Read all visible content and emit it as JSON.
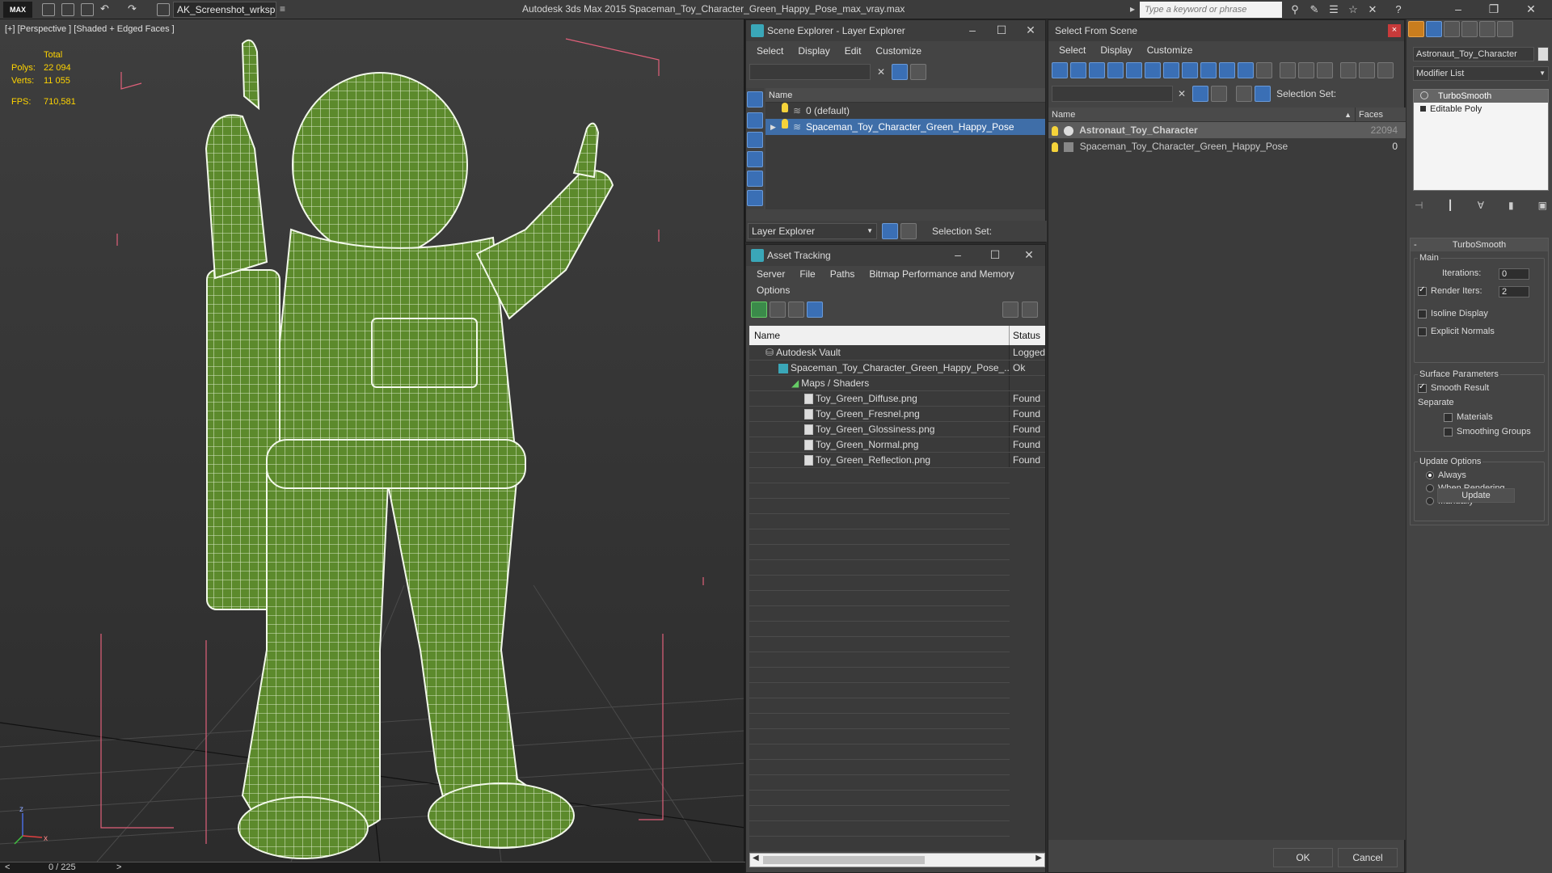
{
  "titlebar": {
    "logo": "MAX",
    "workspace": "AK_Screenshot_wrksp",
    "app_title": "Autodesk 3ds Max  2015     Spaceman_Toy_Character_Green_Happy_Pose_max_vray.max",
    "search_placeholder": "Type a keyword or phrase"
  },
  "viewport": {
    "label": "[+] [Perspective ] [Shaded + Edged Faces ]",
    "stats": {
      "total_label": "Total",
      "polys_label": "Polys:",
      "polys_value": "22 094",
      "verts_label": "Verts:",
      "verts_value": "11 055",
      "fps_label": "FPS:",
      "fps_value": "710,581"
    },
    "axis_x": "x",
    "axis_z": "z",
    "timeline": "0 / 225",
    "timeline_prev": "<",
    "timeline_next": ">"
  },
  "scene_explorer": {
    "title": "Scene Explorer - Layer Explorer",
    "menu": [
      "Select",
      "Display",
      "Edit",
      "Customize"
    ],
    "column": "Name",
    "rows": [
      {
        "label": "0 (default)"
      },
      {
        "label": "Spaceman_Toy_Character_Green_Happy_Pose"
      }
    ],
    "explorer_dropdown": "Layer Explorer",
    "selection_set_label": "Selection Set:"
  },
  "asset_tracking": {
    "title": "Asset Tracking",
    "menu": [
      "Server",
      "File",
      "Paths",
      "Bitmap Performance and Memory"
    ],
    "menu2": "Options",
    "col_name": "Name",
    "col_status": "Status",
    "rows": [
      {
        "name": "Autodesk Vault",
        "status": "Logged",
        "indent": 0
      },
      {
        "name": "Spaceman_Toy_Character_Green_Happy_Pose_...",
        "status": "Ok",
        "indent": 1
      },
      {
        "name": "Maps / Shaders",
        "status": "",
        "indent": 2
      },
      {
        "name": "Toy_Green_Diffuse.png",
        "status": "Found",
        "indent": 3
      },
      {
        "name": "Toy_Green_Fresnel.png",
        "status": "Found",
        "indent": 3
      },
      {
        "name": "Toy_Green_Glossiness.png",
        "status": "Found",
        "indent": 3
      },
      {
        "name": "Toy_Green_Normal.png",
        "status": "Found",
        "indent": 3
      },
      {
        "name": "Toy_Green_Reflection.png",
        "status": "Found",
        "indent": 3
      }
    ]
  },
  "select_from_scene": {
    "title": "Select From Scene",
    "close": "×",
    "menu": [
      "Select",
      "Display",
      "Customize"
    ],
    "selection_set_label": "Selection Set:",
    "col_name": "Name",
    "col_faces": "Faces",
    "rows": [
      {
        "name": "Astronaut_Toy_Character",
        "faces": "22094"
      },
      {
        "name": "Spaceman_Toy_Character_Green_Happy_Pose",
        "faces": "0"
      }
    ],
    "ok": "OK",
    "cancel": "Cancel"
  },
  "command_panel": {
    "object_name": "Astronaut_Toy_Character",
    "modifier_list": "Modifier List",
    "stack": [
      "TurboSmooth",
      "Editable Poly"
    ],
    "rollout_title": "TurboSmooth",
    "rollout_collapse": "-",
    "main_label": "Main",
    "iterations_label": "Iterations:",
    "iterations_value": "0",
    "render_iters_label": "Render Iters:",
    "render_iters_value": "2",
    "isoline_label": "Isoline Display",
    "explicit_normals_label": "Explicit Normals",
    "surface_label": "Surface Parameters",
    "smooth_result_label": "Smooth Result",
    "separate_label": "Separate",
    "materials_label": "Materials",
    "smoothing_groups_label": "Smoothing Groups",
    "update_options_label": "Update Options",
    "always_label": "Always",
    "when_rendering_label": "When Rendering",
    "manually_label": "Manually",
    "update_button": "Update"
  },
  "colors": {
    "accent_blue": "#3f6ea8",
    "stat_yellow": "#ffd400",
    "model_green": "#5f8c2e",
    "bbox_pink": "#e0607a"
  }
}
